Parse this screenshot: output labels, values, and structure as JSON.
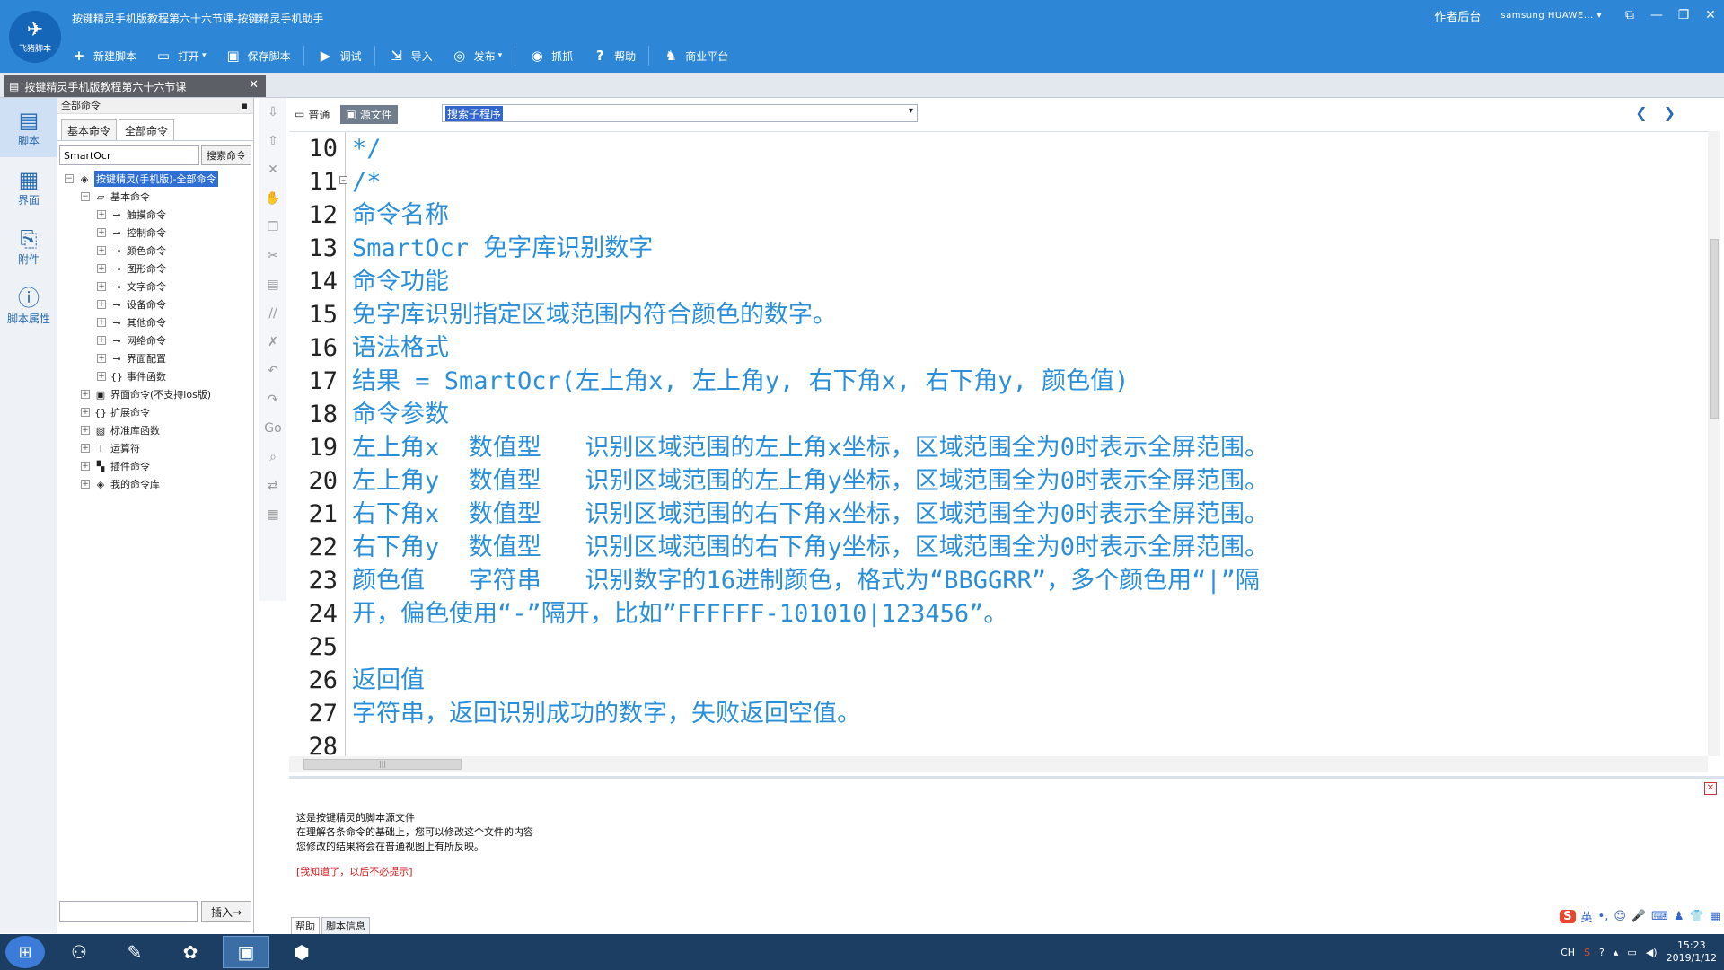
{
  "window": {
    "title": "按键精灵手机版教程第六十六节课-按键精灵手机助手",
    "logo_text": "飞猪脚本",
    "author_link": "作者后台",
    "device": "samsung HUAWE..."
  },
  "toolbar": [
    {
      "label": "新建脚本",
      "icon": "plus-icon",
      "glyph": "+"
    },
    {
      "label": "打开",
      "icon": "folder-open-icon",
      "glyph": "▭",
      "dropdown": "▾"
    },
    {
      "label": "保存脚本",
      "icon": "save-icon",
      "glyph": "▣"
    },
    {
      "label": "调试",
      "icon": "play-icon",
      "glyph": "▶"
    },
    {
      "label": "导入",
      "icon": "import-icon",
      "glyph": "⇲"
    },
    {
      "label": "发布",
      "icon": "publish-icon",
      "glyph": "◎",
      "dropdown": "▾"
    },
    {
      "label": "抓抓",
      "icon": "camera-icon",
      "glyph": "◉"
    },
    {
      "label": "帮助",
      "icon": "help-icon",
      "glyph": "?"
    },
    {
      "label": "商业平台",
      "icon": "business-icon",
      "glyph": "♞"
    }
  ],
  "doc_tab": {
    "label": "按键精灵手机版教程第六十六节课"
  },
  "leftnav": [
    {
      "label": "脚本",
      "icon": "script-icon",
      "glyph": "▤",
      "active": true
    },
    {
      "label": "界面",
      "icon": "ui-grid-icon",
      "glyph": "▦"
    },
    {
      "label": "附件",
      "icon": "attachment-icon",
      "glyph": "⎘"
    },
    {
      "label": "脚本属性",
      "icon": "info-icon",
      "glyph": "ⓘ"
    }
  ],
  "cmdpanel": {
    "title": "全部命令",
    "tabs": [
      "基本命令",
      "全部命令"
    ],
    "search_value": "SmartOcr",
    "search_button": "搜索命令",
    "insert_button": "插入→"
  },
  "tree": [
    {
      "depth": 0,
      "label": "按键精灵(手机版)-全部命令",
      "toggle": "−",
      "icon": "package-icon",
      "glyph": "◈",
      "selected": true
    },
    {
      "depth": 1,
      "label": "基本命令",
      "toggle": "−",
      "icon": "folder-icon",
      "glyph": "▱"
    },
    {
      "depth": 2,
      "label": "触摸命令",
      "toggle": "+",
      "icon": "key-icon",
      "glyph": "⊸"
    },
    {
      "depth": 2,
      "label": "控制命令",
      "toggle": "+",
      "icon": "key-icon",
      "glyph": "⊸"
    },
    {
      "depth": 2,
      "label": "颜色命令",
      "toggle": "+",
      "icon": "key-icon",
      "glyph": "⊸"
    },
    {
      "depth": 2,
      "label": "图形命令",
      "toggle": "+",
      "icon": "key-icon",
      "glyph": "⊸"
    },
    {
      "depth": 2,
      "label": "文字命令",
      "toggle": "+",
      "icon": "key-icon",
      "glyph": "⊸"
    },
    {
      "depth": 2,
      "label": "设备命令",
      "toggle": "+",
      "icon": "key-icon",
      "glyph": "⊸"
    },
    {
      "depth": 2,
      "label": "其他命令",
      "toggle": "+",
      "icon": "key-icon",
      "glyph": "⊸"
    },
    {
      "depth": 2,
      "label": "网络命令",
      "toggle": "+",
      "icon": "key-icon",
      "glyph": "⊸"
    },
    {
      "depth": 2,
      "label": "界面配置",
      "toggle": "+",
      "icon": "key-icon",
      "glyph": "⊸"
    },
    {
      "depth": 2,
      "label": "事件函数",
      "toggle": "+",
      "icon": "braces-icon",
      "glyph": "{}"
    },
    {
      "depth": 1,
      "label": "界面命令(不支持ios版)",
      "toggle": "+",
      "icon": "window-icon",
      "glyph": "▣"
    },
    {
      "depth": 1,
      "label": "扩展命令",
      "toggle": "+",
      "icon": "braces-icon",
      "glyph": "{}"
    },
    {
      "depth": 1,
      "label": "标准库函数",
      "toggle": "+",
      "icon": "library-icon",
      "glyph": "▧"
    },
    {
      "depth": 1,
      "label": "运算符",
      "toggle": "+",
      "icon": "operator-icon",
      "glyph": "⊤"
    },
    {
      "depth": 1,
      "label": "插件命令",
      "toggle": "+",
      "icon": "plugin-icon",
      "glyph": "▚"
    },
    {
      "depth": 1,
      "label": "我的命令库",
      "toggle": "+",
      "icon": "package-icon",
      "glyph": "◈"
    }
  ],
  "actionstrip": [
    {
      "icon": "move-down-icon",
      "glyph": "⇩"
    },
    {
      "icon": "move-up-icon",
      "glyph": "⇧"
    },
    {
      "icon": "delete-icon",
      "glyph": "✕"
    },
    {
      "icon": "hand-icon",
      "glyph": "✋"
    },
    {
      "icon": "copy-icon",
      "glyph": "❐"
    },
    {
      "icon": "cut-icon",
      "glyph": "✂"
    },
    {
      "icon": "paste-icon",
      "glyph": "▤"
    },
    {
      "icon": "comment-icon",
      "glyph": "//"
    },
    {
      "icon": "uncomment-icon",
      "glyph": "✗"
    },
    {
      "icon": "undo-icon",
      "glyph": "↶"
    },
    {
      "icon": "redo-icon",
      "glyph": "↷"
    },
    {
      "icon": "goto-icon",
      "glyph": "Go"
    },
    {
      "icon": "find-icon",
      "glyph": "⌕"
    },
    {
      "icon": "replace-icon",
      "glyph": "⇄"
    },
    {
      "icon": "properties-icon",
      "glyph": "▦"
    }
  ],
  "editor": {
    "view_tabs": [
      {
        "label": "普通",
        "icon": "normal-view-icon",
        "glyph": "▭",
        "active": false
      },
      {
        "label": "源文件",
        "icon": "source-view-icon",
        "glyph": "▣",
        "active": true
      }
    ],
    "subroutine_select": "搜索子程序",
    "nav_prev": "❮",
    "nav_next": "❯"
  },
  "code_lines": [
    {
      "n": "10",
      "fold": "",
      "text": "*/"
    },
    {
      "n": "11",
      "fold": "−",
      "text": "/*"
    },
    {
      "n": "12",
      "fold": "",
      "text": "命令名称"
    },
    {
      "n": "13",
      "fold": "",
      "text": "SmartOcr 免字库识别数字"
    },
    {
      "n": "14",
      "fold": "",
      "text": "命令功能"
    },
    {
      "n": "15",
      "fold": "",
      "text": "免字库识别指定区域范围内符合颜色的数字。"
    },
    {
      "n": "16",
      "fold": "",
      "text": "语法格式"
    },
    {
      "n": "17",
      "fold": "",
      "text": "结果 = SmartOcr(左上角x, 左上角y, 右下角x, 右下角y, 颜色值)"
    },
    {
      "n": "18",
      "fold": "",
      "text": "命令参数"
    },
    {
      "n": "19",
      "fold": "",
      "text": "左上角x  数值型   识别区域范围的左上角x坐标，区域范围全为0时表示全屏范围。"
    },
    {
      "n": "20",
      "fold": "",
      "text": "左上角y  数值型   识别区域范围的左上角y坐标，区域范围全为0时表示全屏范围。"
    },
    {
      "n": "21",
      "fold": "",
      "text": "右下角x  数值型   识别区域范围的右下角x坐标，区域范围全为0时表示全屏范围。"
    },
    {
      "n": "22",
      "fold": "",
      "text": "右下角y  数值型   识别区域范围的右下角y坐标，区域范围全为0时表示全屏范围。"
    },
    {
      "n": "23",
      "fold": "",
      "text": "颜色值   字符串   识别数字的16进制颜色，格式为“BBGGRR”，多个颜色用“|”隔"
    },
    {
      "n": "24",
      "fold": "",
      "text": "开，偏色使用“-”隔开，比如”FFFFFF-101010|123456”。"
    },
    {
      "n": "25",
      "fold": "",
      "text": ""
    },
    {
      "n": "26",
      "fold": "",
      "text": "返回值"
    },
    {
      "n": "27",
      "fold": "",
      "text": "字符串，返回识别成功的数字，失败返回空值。"
    },
    {
      "n": "28",
      "fold": "",
      "text": ""
    }
  ],
  "help": {
    "line1": "这是按键精灵的脚本源文件",
    "line2": "在理解各条命令的基础上，您可以修改这个文件的内容",
    "line3": "您修改的结果将会在普通视图上有所反映。",
    "dismiss": "[我知道了，以后不必提示]",
    "tabs": [
      "帮助",
      "脚本信息"
    ]
  },
  "ime": {
    "logo": "S",
    "lang": "英",
    "items": [
      "•,",
      "☺",
      "🎤",
      "⌨",
      "♟",
      "👕",
      "▦"
    ]
  },
  "taskbar": {
    "apps": [
      {
        "icon": "app-cloud-icon",
        "glyph": "⚇"
      },
      {
        "icon": "app-brush-icon",
        "glyph": "✎"
      },
      {
        "icon": "app-color-icon",
        "glyph": "✿"
      },
      {
        "icon": "app-robot-icon",
        "glyph": "▣",
        "active": true
      },
      {
        "icon": "app-nox-icon",
        "glyph": "⬢"
      }
    ],
    "tray_lang": "CH",
    "time": "15:23",
    "date": "2019/1/12"
  },
  "colors": {
    "titlebar": "#2d86d6",
    "code_text": "#2a8fd8",
    "selection": "#2f6fd3"
  }
}
